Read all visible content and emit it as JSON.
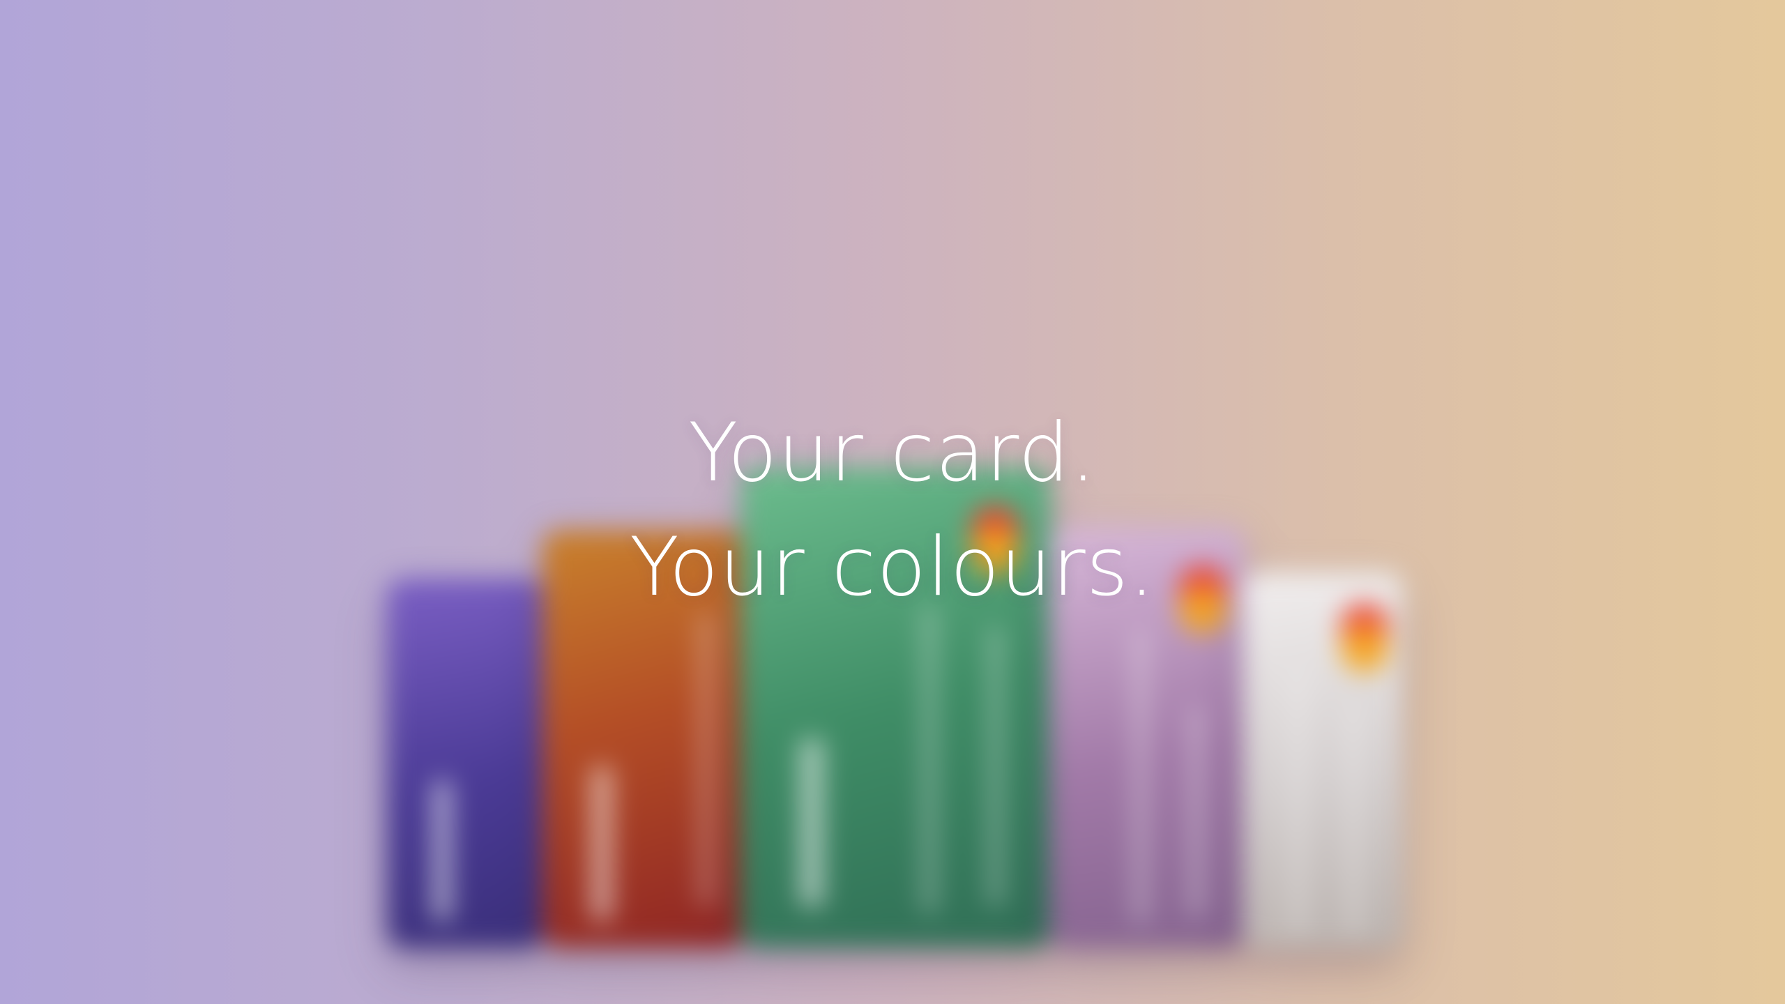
{
  "hero": {
    "line1": "Your card.",
    "line2": "Your colours."
  },
  "background": {
    "gradient_start": "#b1a5d8",
    "gradient_end": "#e4c89c"
  },
  "cards": [
    {
      "name": "purple-card",
      "color": "#4b3b96"
    },
    {
      "name": "orange-card",
      "color": "#b44e26"
    },
    {
      "name": "green-card",
      "color": "#3f8d66"
    },
    {
      "name": "lilac-card",
      "color": "#a27aa8"
    },
    {
      "name": "silver-card",
      "color": "#d4cfcf"
    }
  ]
}
